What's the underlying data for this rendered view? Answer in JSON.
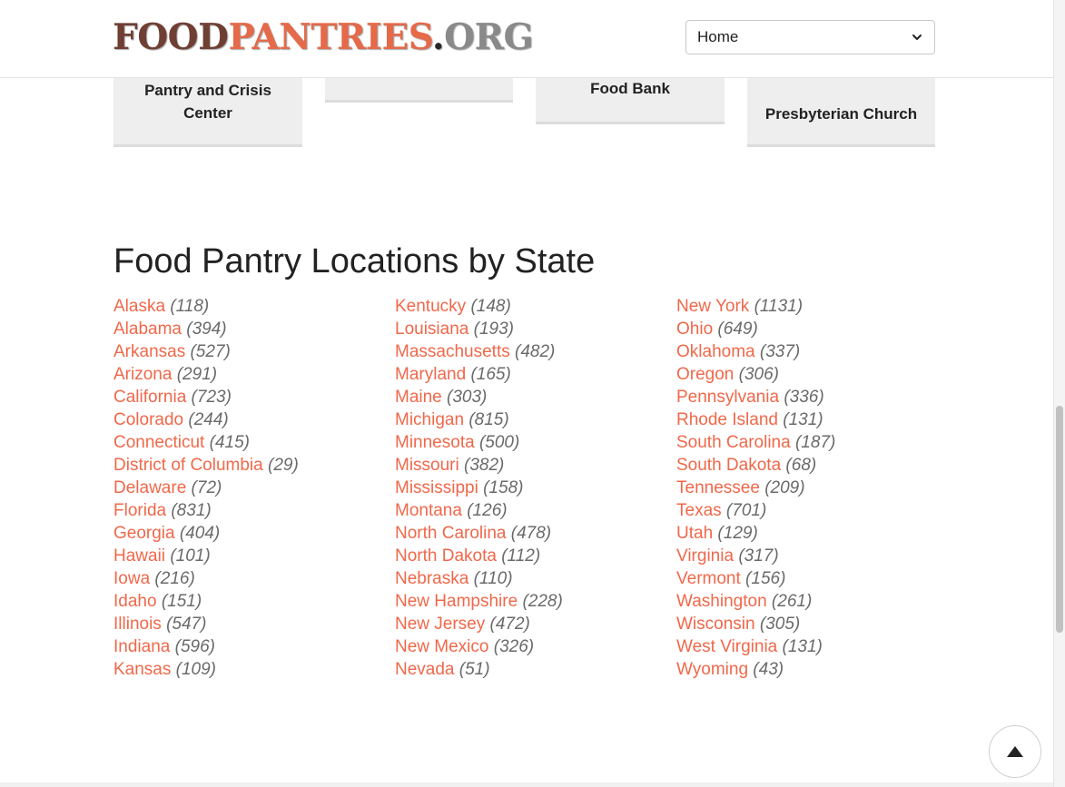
{
  "header": {
    "logo": {
      "part1": "FOOD",
      "part2": "PANTRIES",
      "part3": ".",
      "part4": "ORG"
    },
    "nav_select": {
      "selected": "Home"
    }
  },
  "cards": [
    {
      "title": "Pantry and Crisis Center"
    },
    {
      "title": ""
    },
    {
      "title": "Food Bank"
    },
    {
      "title": "Presbyterian Church"
    }
  ],
  "section": {
    "title": "Food Pantry Locations by State",
    "columns": [
      [
        {
          "name": "Alaska",
          "count": "(118)"
        },
        {
          "name": "Alabama",
          "count": "(394)"
        },
        {
          "name": "Arkansas",
          "count": "(527)"
        },
        {
          "name": "Arizona",
          "count": "(291)"
        },
        {
          "name": "California",
          "count": "(723)"
        },
        {
          "name": "Colorado",
          "count": "(244)"
        },
        {
          "name": "Connecticut",
          "count": "(415)"
        },
        {
          "name": "District of Columbia",
          "count": "(29)"
        },
        {
          "name": "Delaware",
          "count": "(72)"
        },
        {
          "name": "Florida",
          "count": "(831)"
        },
        {
          "name": "Georgia",
          "count": "(404)"
        },
        {
          "name": "Hawaii",
          "count": "(101)"
        },
        {
          "name": "Iowa",
          "count": "(216)"
        },
        {
          "name": "Idaho",
          "count": "(151)"
        },
        {
          "name": "Illinois",
          "count": "(547)"
        },
        {
          "name": "Indiana",
          "count": "(596)"
        },
        {
          "name": "Kansas",
          "count": "(109)"
        }
      ],
      [
        {
          "name": "Kentucky",
          "count": "(148)"
        },
        {
          "name": "Louisiana",
          "count": "(193)"
        },
        {
          "name": "Massachusetts",
          "count": "(482)"
        },
        {
          "name": "Maryland",
          "count": "(165)"
        },
        {
          "name": "Maine",
          "count": "(303)"
        },
        {
          "name": "Michigan",
          "count": "(815)"
        },
        {
          "name": "Minnesota",
          "count": "(500)"
        },
        {
          "name": "Missouri",
          "count": "(382)"
        },
        {
          "name": "Mississippi",
          "count": "(158)"
        },
        {
          "name": "Montana",
          "count": "(126)"
        },
        {
          "name": "North Carolina",
          "count": "(478)"
        },
        {
          "name": "North Dakota",
          "count": "(112)"
        },
        {
          "name": "Nebraska",
          "count": "(110)"
        },
        {
          "name": "New Hampshire",
          "count": "(228)"
        },
        {
          "name": "New Jersey",
          "count": "(472)"
        },
        {
          "name": "New Mexico",
          "count": "(326)"
        },
        {
          "name": "Nevada",
          "count": "(51)"
        }
      ],
      [
        {
          "name": "New York",
          "count": "(1131)"
        },
        {
          "name": "Ohio",
          "count": "(649)"
        },
        {
          "name": "Oklahoma",
          "count": "(337)"
        },
        {
          "name": "Oregon",
          "count": "(306)"
        },
        {
          "name": "Pennsylvania",
          "count": "(336)"
        },
        {
          "name": "Rhode Island",
          "count": "(131)"
        },
        {
          "name": "South Carolina",
          "count": "(187)"
        },
        {
          "name": "South Dakota",
          "count": "(68)"
        },
        {
          "name": "Tennessee",
          "count": "(209)"
        },
        {
          "name": "Texas",
          "count": "(701)"
        },
        {
          "name": "Utah",
          "count": "(129)"
        },
        {
          "name": "Virginia",
          "count": "(317)"
        },
        {
          "name": "Vermont",
          "count": "(156)"
        },
        {
          "name": "Washington",
          "count": "(261)"
        },
        {
          "name": "Wisconsin",
          "count": "(305)"
        },
        {
          "name": "West Virginia",
          "count": "(131)"
        },
        {
          "name": "Wyoming",
          "count": "(43)"
        }
      ]
    ]
  },
  "icons": {
    "select_caret": "chevron-down-icon",
    "back_to_top": "triangle-up-icon"
  },
  "colors": {
    "link": "#f0684a",
    "count": "#6a6a6a",
    "logo_dark": "#6f3f34",
    "logo_accent": "#e46a4a",
    "card_bg": "#eeeeee"
  }
}
